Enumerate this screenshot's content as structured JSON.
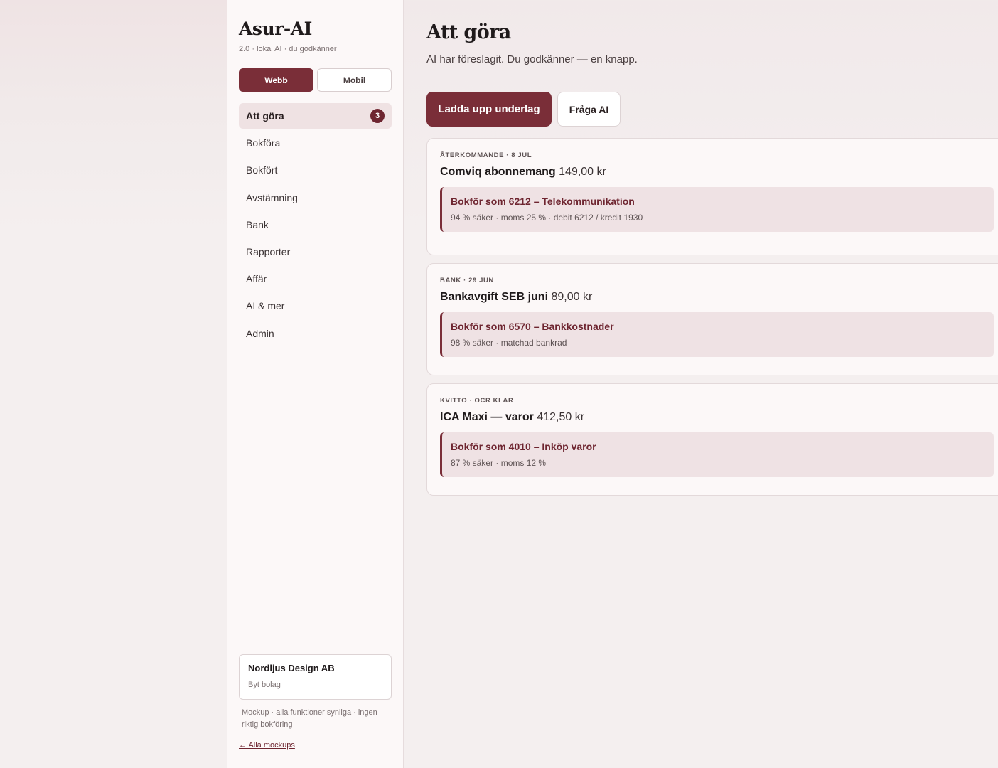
{
  "sidebar": {
    "brand_title": "Asur-AI",
    "brand_sub": "2.0 · lokal AI · du godkänner",
    "modes": {
      "webb": "Webb",
      "mobil": "Mobil"
    },
    "nav": [
      {
        "label": "Att göra",
        "badge": "3"
      },
      {
        "label": "Bokföra"
      },
      {
        "label": "Bokfört"
      },
      {
        "label": "Avstämning"
      },
      {
        "label": "Bank"
      },
      {
        "label": "Rapporter"
      },
      {
        "label": "Affär"
      },
      {
        "label": "AI & mer"
      },
      {
        "label": "Admin"
      }
    ],
    "company": {
      "name": "Nordljus Design AB",
      "switch_label": "Byt bolag"
    },
    "mock_note": "Mockup · alla funktioner synliga · ingen riktig bokföring",
    "all_mockups": "← Alla mockups"
  },
  "main": {
    "title": "Att göra",
    "subtitle": "AI har föreslagit. Du godkänner — en knapp.",
    "btn_upload": "Ladda upp underlag",
    "btn_ask": "Fråga AI",
    "tasks": [
      {
        "meta": "Återkommande · 8 jul",
        "title": "Comviq abonnemang",
        "amount": "149,00 kr",
        "suggestion_title": "Bokför som 6212 – Telekommunikation",
        "suggestion_detail": "94 % säker · moms 25 % · debit 6212 / kredit 1930"
      },
      {
        "meta": "Bank · 29 jun",
        "title": "Bankavgift SEB juni",
        "amount": "89,00 kr",
        "suggestion_title": "Bokför som 6570 – Bankkostnader",
        "suggestion_detail": "98 % säker · matchad bankrad"
      },
      {
        "meta": "Kvitto · OCR klar",
        "title": "ICA Maxi — varor",
        "amount": "412,50 kr",
        "suggestion_title": "Bokför som 4010 – Inköp varor",
        "suggestion_detail": "87 % säker · moms 12 %"
      }
    ]
  },
  "colors": {
    "accent": "#7a2e38",
    "accent_dark": "#6e2530",
    "suggestion_bg": "#efe2e4",
    "sidebar_bg": "#fcf8f8"
  }
}
